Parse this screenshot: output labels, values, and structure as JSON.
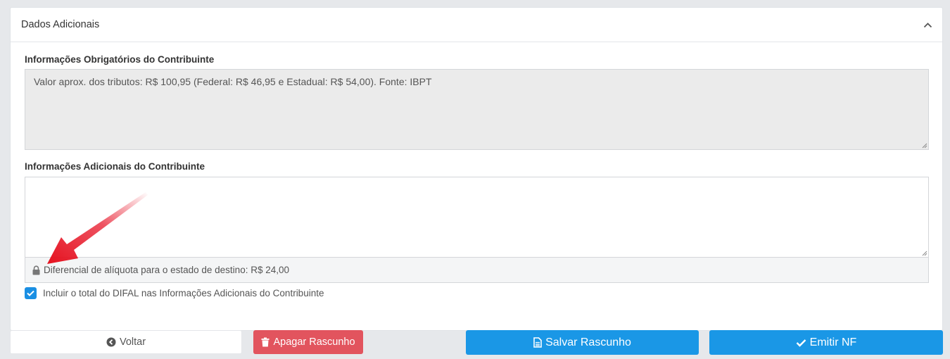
{
  "panel": {
    "title": "Dados Adicionais"
  },
  "fields": {
    "mandatory_label": "Informações Obrigatórios do Contribuinte",
    "mandatory_value": "Valor aprox. dos tributos: R$ 100,95 (Federal: R$ 46,95 e Estadual: R$ 54,00). Fonte: IBPT",
    "additional_label": "Informações Adicionais do Contribuinte",
    "additional_value": "",
    "difal_note": "Diferencial de alíquota para o estado de destino: R$ 24,00",
    "include_difal_label": "Incluir o total do DIFAL nas Informações Adicionais do Contribuinte",
    "include_difal_checked": true
  },
  "actions": {
    "back_label": "Voltar",
    "delete_draft_label": "Apagar Rascunho",
    "save_draft_label": "Salvar Rascunho",
    "emit_label": "Emitir NF"
  },
  "colors": {
    "primary": "#1a97e6",
    "danger": "#e2545e",
    "annotation_arrow": "#e8192c"
  },
  "icons": {
    "collapse": "chevron-up-icon",
    "lock": "lock-icon",
    "back": "arrow-circle-left-icon",
    "delete": "trash-icon",
    "save": "file-icon",
    "emit": "check-icon"
  }
}
